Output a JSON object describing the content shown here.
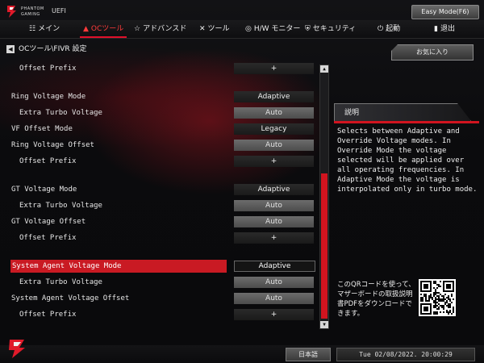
{
  "header": {
    "brand_line1": "PHANTOM",
    "brand_line2": "GAMING",
    "uefi": "UEFI",
    "easy_mode": "Easy Mode(F6)"
  },
  "nav": {
    "tabs": [
      {
        "label": "メイン",
        "icon": "grid-icon"
      },
      {
        "label": "OCツール",
        "icon": "rocket-icon",
        "active": true
      },
      {
        "label": "アドバンスド",
        "icon": "star-icon"
      },
      {
        "label": "ツール",
        "icon": "tools-icon"
      },
      {
        "label": "H/W モニター",
        "icon": "monitor-icon"
      },
      {
        "label": "セキュリティ",
        "icon": "shield-icon"
      },
      {
        "label": "起動",
        "icon": "power-icon"
      },
      {
        "label": "退出",
        "icon": "exit-icon"
      }
    ]
  },
  "breadcrumb": "OCツール\\FIVR 設定",
  "rows": [
    {
      "label": "Offset Prefix",
      "value": "+",
      "indent": true,
      "style": "dark"
    },
    {
      "label": "Ring Voltage Mode",
      "value": "Adaptive",
      "indent": false,
      "style": "dark"
    },
    {
      "label": "Extra Turbo Voltage",
      "value": "Auto",
      "indent": true,
      "style": "gray"
    },
    {
      "label": "VF Offset Mode",
      "value": "Legacy",
      "indent": false,
      "style": "dark"
    },
    {
      "label": "Ring Voltage Offset",
      "value": "Auto",
      "indent": false,
      "style": "gray"
    },
    {
      "label": "Offset Prefix",
      "value": "+",
      "indent": true,
      "style": "dark"
    },
    {
      "label": "GT Voltage Mode",
      "value": "Adaptive",
      "indent": false,
      "style": "dark"
    },
    {
      "label": "Extra Turbo Voltage",
      "value": "Auto",
      "indent": true,
      "style": "gray"
    },
    {
      "label": "GT Voltage Offset",
      "value": "Auto",
      "indent": false,
      "style": "gray"
    },
    {
      "label": "Offset Prefix",
      "value": "+",
      "indent": true,
      "style": "dark"
    },
    {
      "label": "System Agent Voltage Mode",
      "value": "Adaptive",
      "indent": false,
      "style": "hl",
      "selected": true
    },
    {
      "label": "Extra Turbo Voltage",
      "value": "Auto",
      "indent": true,
      "style": "gray"
    },
    {
      "label": "System Agent Voltage Offset",
      "value": "Auto",
      "indent": false,
      "style": "gray"
    },
    {
      "label": "Offset Prefix",
      "value": "+",
      "indent": true,
      "style": "dark"
    }
  ],
  "right_panel": {
    "favorite": "お気に入り",
    "description_title": "説明",
    "description": "Selects between Adaptive and Override Voltage modes. In Override Mode the voltage selected will be applied over all operating frequencies. In Adaptive Mode the voltage is interpolated only in turbo mode.",
    "qr_text": "このQRコードを使って、マザーボードの取扱説明書PDFをダウンロードできます。"
  },
  "footer": {
    "language": "日本語",
    "datetime": "Tue 02/08/2022. 20:00:29"
  },
  "colors": {
    "accent": "#d1141f",
    "highlight_row": "#c91a23"
  }
}
